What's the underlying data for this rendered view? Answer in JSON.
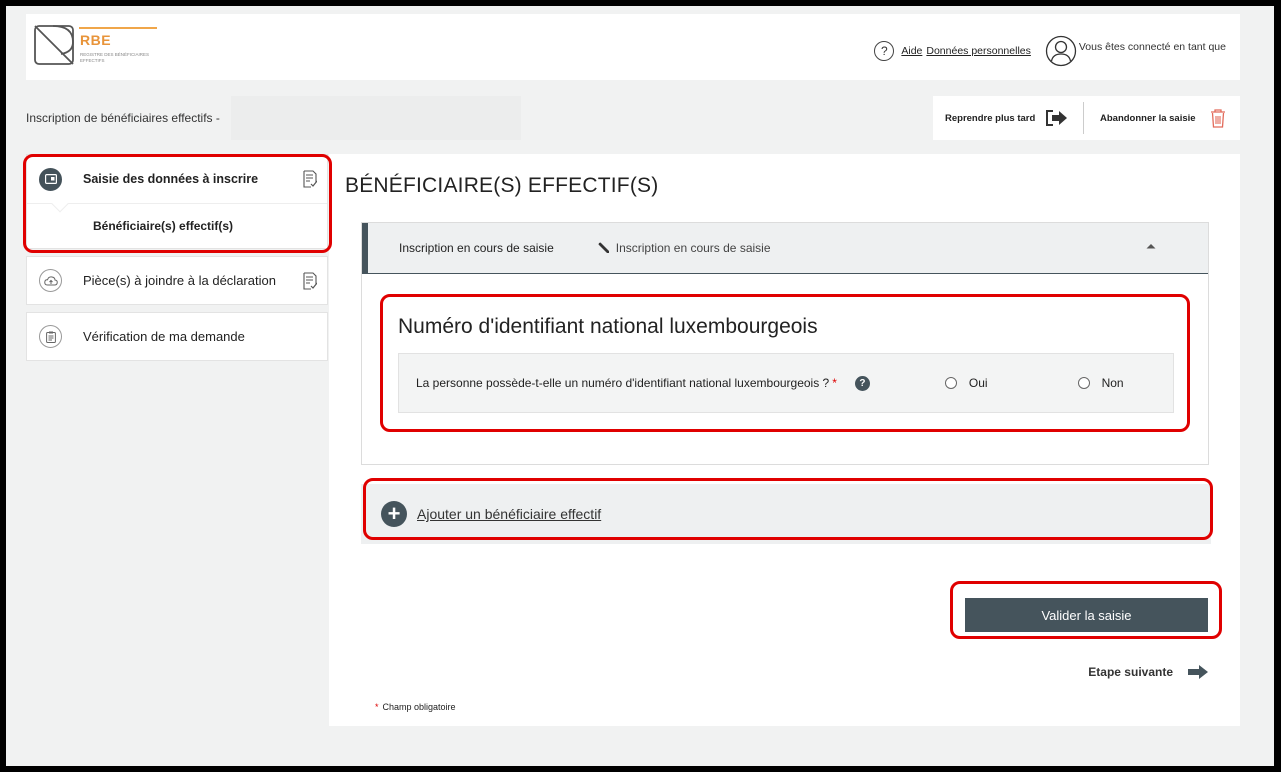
{
  "brand": {
    "abbr": "RBE",
    "full_name": "Registre des bénéficiaires effectifs",
    "accent_color": "#e8943a"
  },
  "header": {
    "help_link": "Aide",
    "privacy_link": "Données personnelles",
    "user_text": "Vous êtes connecté en tant que",
    "icons": [
      "help-icon",
      "user-icon"
    ]
  },
  "title_bar": {
    "subtitle": "Inscription de bénéficiaires effectifs -",
    "resume_later": "Reprendre plus tard",
    "abandon": "Abandonner la saisie"
  },
  "sidebar": {
    "items": [
      {
        "label": "Saisie des données à inscrire",
        "icon": "form-icon",
        "active": true,
        "sub_items": [
          "Bénéficiaire(s) effectif(s)"
        ]
      },
      {
        "label": "Pièce(s) à joindre à la déclaration",
        "icon": "cloud-upload-icon",
        "active": false
      },
      {
        "label": "Vérification de ma demande",
        "icon": "clipboard-icon",
        "active": false
      }
    ]
  },
  "main": {
    "page_title": "BÉNÉFICIAIRE(S) EFFECTIF(S)",
    "section": {
      "header_label": "Inscription en cours de saisie",
      "header_status": "Inscription en cours de saisie",
      "id_title": "Numéro d'identifiant national luxembourgeois",
      "question": "La personne possède-t-elle un numéro d'identifiant national luxembourgeois ?",
      "required_mark": "*",
      "options": [
        "Oui",
        "Non"
      ]
    },
    "add_label": "Ajouter un bénéficiaire effectif",
    "validate_label": "Valider la saisie",
    "next_step_label": "Etape suivante",
    "mandatory_note": "Champ obligatoire"
  },
  "colors": {
    "primary_dark": "#45545c",
    "annotation_red": "#e00000",
    "required_red": "#dd0000"
  }
}
